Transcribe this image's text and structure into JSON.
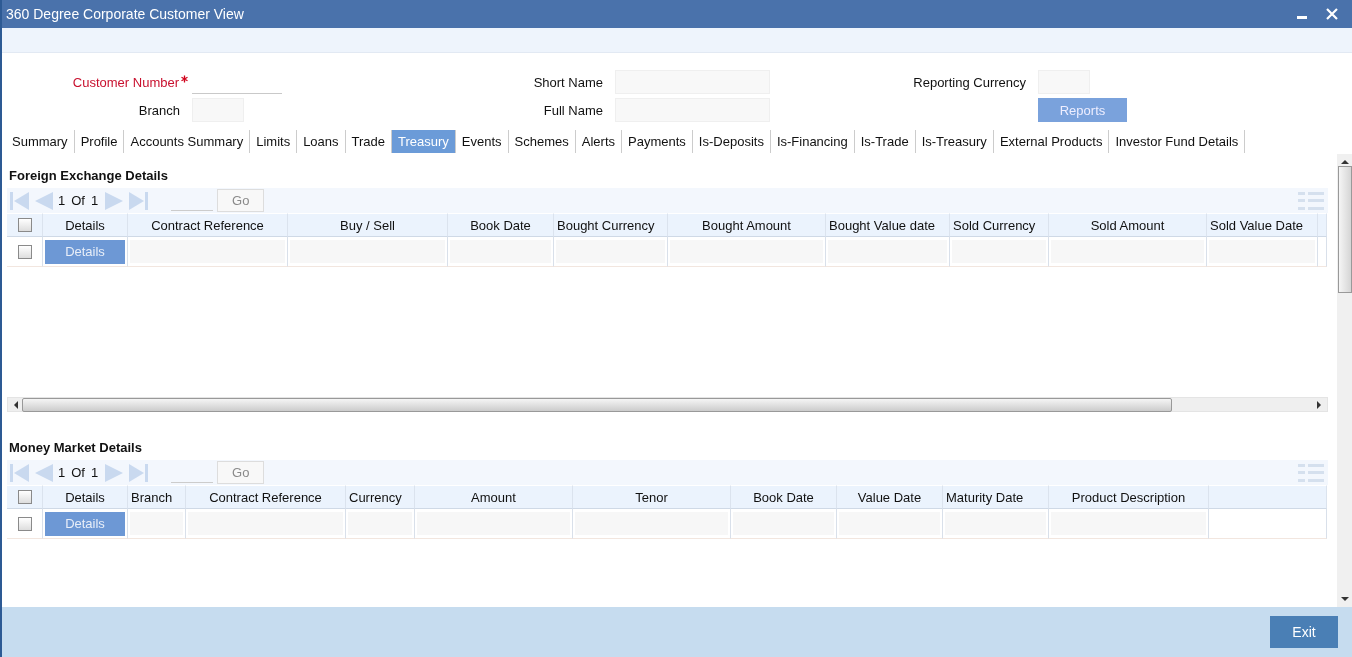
{
  "window": {
    "title": "360 Degree Corporate Customer View"
  },
  "form": {
    "fields": [
      {
        "kind": "line",
        "label": "Customer Number",
        "required": true
      },
      {
        "kind": "box",
        "label": "Branch",
        "required": false
      },
      {
        "kind": "box",
        "label": "Short Name",
        "required": false
      },
      {
        "kind": "box",
        "label": "Full Name",
        "required": false
      },
      {
        "kind": "box",
        "label": "Reporting Currency",
        "required": false
      }
    ],
    "reports_button": "Reports"
  },
  "tabs": [
    {
      "label": "Summary",
      "selected": false
    },
    {
      "label": "Profile",
      "selected": false
    },
    {
      "label": "Accounts Summary",
      "selected": false
    },
    {
      "label": "Limits",
      "selected": false
    },
    {
      "label": "Loans",
      "selected": false
    },
    {
      "label": "Trade",
      "selected": false
    },
    {
      "label": "Treasury",
      "selected": true
    },
    {
      "label": "Events",
      "selected": false
    },
    {
      "label": "Schemes",
      "selected": false
    },
    {
      "label": "Alerts",
      "selected": false
    },
    {
      "label": "Payments",
      "selected": false
    },
    {
      "label": "Is-Deposits",
      "selected": false
    },
    {
      "label": "Is-Financing",
      "selected": false
    },
    {
      "label": "Is-Trade",
      "selected": false
    },
    {
      "label": "Is-Treasury",
      "selected": false
    },
    {
      "label": "External Products",
      "selected": false
    },
    {
      "label": "Investor Fund Details",
      "selected": false
    }
  ],
  "sections": [
    {
      "title": "Foreign Exchange Details",
      "pager": {
        "current": "1",
        "of": "Of",
        "total": "1",
        "go": "Go"
      },
      "select_all_checked": false,
      "columns": [
        "Details",
        "Contract Reference",
        "Buy / Sell",
        "Book Date",
        "Bought Currency",
        "Bought Amount",
        "Bought Value date",
        "Sold Currency",
        "Sold Amount",
        "Sold Value Date"
      ],
      "rows": [
        {
          "checked": false,
          "details": "Details"
        }
      ]
    },
    {
      "title": "Money Market Details",
      "pager": {
        "current": "1",
        "of": "Of",
        "total": "1",
        "go": "Go"
      },
      "select_all_checked": false,
      "columns": [
        "Details",
        "Branch",
        "Contract Reference",
        "Currency",
        "Amount",
        "Tenor",
        "Book Date",
        "Value Date",
        "Maturity Date",
        "Product Description"
      ],
      "rows": [
        {
          "checked": false,
          "details": "Details"
        }
      ]
    }
  ],
  "footer": {
    "exit": "Exit"
  }
}
